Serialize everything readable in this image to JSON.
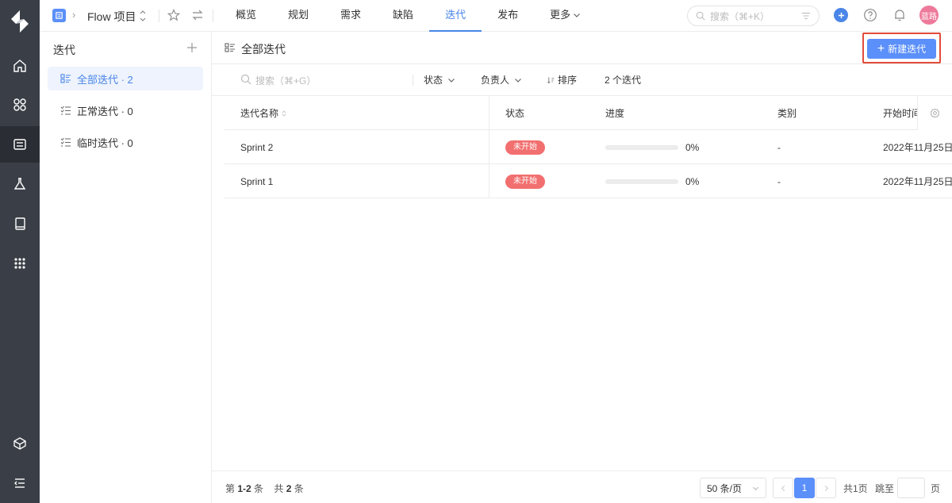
{
  "topbar": {
    "project_name": "Flow 项目",
    "tabs": [
      {
        "label": "概览",
        "active": false
      },
      {
        "label": "规划",
        "active": false
      },
      {
        "label": "需求",
        "active": false
      },
      {
        "label": "缺陷",
        "active": false
      },
      {
        "label": "迭代",
        "active": true
      },
      {
        "label": "发布",
        "active": false
      },
      {
        "label": "更多",
        "active": false
      }
    ],
    "search_placeholder": "搜索（⌘+K）",
    "avatar_text": "蓝路"
  },
  "sidebar": {
    "title": "迭代",
    "items": [
      {
        "label": "全部迭代 · 2",
        "active": true
      },
      {
        "label": "正常迭代 · 0",
        "active": false
      },
      {
        "label": "临时迭代 · 0",
        "active": false
      }
    ]
  },
  "main": {
    "title": "全部迭代",
    "new_button": "新建迭代",
    "filters": {
      "search_placeholder": "搜索（⌘+G）",
      "status": "状态",
      "assignee": "负责人",
      "sort": "排序",
      "count": "2 个迭代"
    },
    "table": {
      "columns": [
        "迭代名称",
        "状态",
        "进度",
        "类别",
        "开始时间"
      ],
      "rows": [
        {
          "name": "Sprint 2",
          "status": "未开始",
          "progress": 0,
          "progress_text": "0%",
          "category": "-",
          "start": "2022年11月25日"
        },
        {
          "name": "Sprint 1",
          "status": "未开始",
          "progress": 0,
          "progress_text": "0%",
          "category": "-",
          "start": "2022年11月25日"
        }
      ]
    },
    "footer": {
      "range_prefix": "第",
      "range": "1-2",
      "range_suffix": "条",
      "total_prefix": "共",
      "total": "2",
      "total_suffix": "条",
      "page_size": "50 条/页",
      "current_page": "1",
      "total_pages": "共1页",
      "jump_label": "跳至",
      "page_unit": "页"
    }
  },
  "colors": {
    "accent": "#5b8ff9",
    "badge": "#f26f6f",
    "rail": "#3a3f47",
    "highlight_border": "#e24c3a"
  }
}
